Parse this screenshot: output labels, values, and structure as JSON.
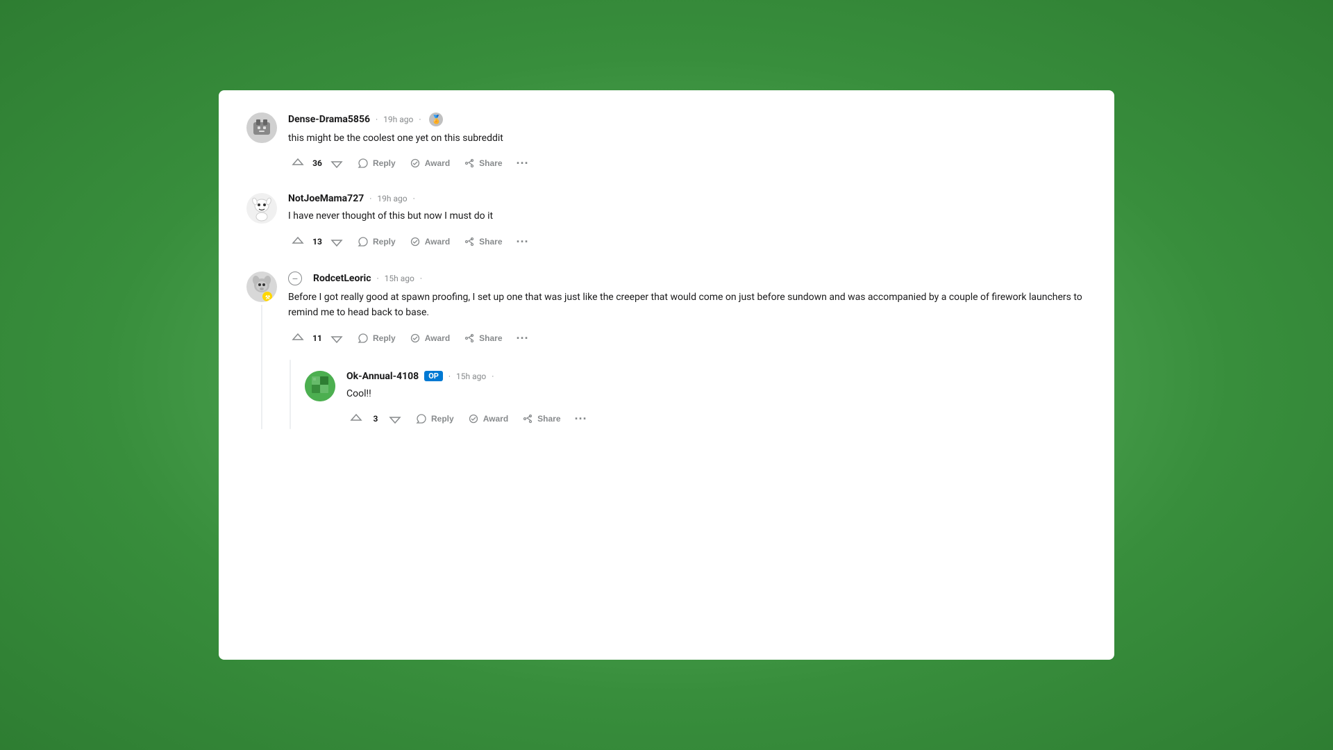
{
  "comments": [
    {
      "id": "comment-1",
      "username": "Dense-Drama5856",
      "time": "19h ago",
      "has_award": true,
      "text": "this might be the coolest one yet on this subreddit",
      "votes": "36",
      "actions": {
        "reply": "Reply",
        "award": "Award",
        "share": "Share"
      }
    },
    {
      "id": "comment-2",
      "username": "NotJoeMama727",
      "time": "19h ago",
      "has_award": false,
      "text": "I have never thought of this but now I must do it",
      "votes": "13",
      "actions": {
        "reply": "Reply",
        "award": "Award",
        "share": "Share"
      }
    },
    {
      "id": "comment-3",
      "username": "RodcetLeoric",
      "time": "15h ago",
      "has_award": false,
      "text": "Before I got really good at spawn proofing, I set up one that was just like the creeper that would come on just before sundown and was accompanied by a couple of firework launchers to remind me to head back to base.",
      "votes": "11",
      "collapsed": true,
      "actions": {
        "reply": "Reply",
        "award": "Award",
        "share": "Share"
      },
      "replies": [
        {
          "id": "comment-3-1",
          "username": "Ok-Annual-4108",
          "op": true,
          "time": "15h ago",
          "text": "Cool!!",
          "votes": "3",
          "actions": {
            "reply": "Reply",
            "award": "Award",
            "share": "Share"
          }
        }
      ]
    }
  ],
  "more_label": "...",
  "op_label": "OP"
}
